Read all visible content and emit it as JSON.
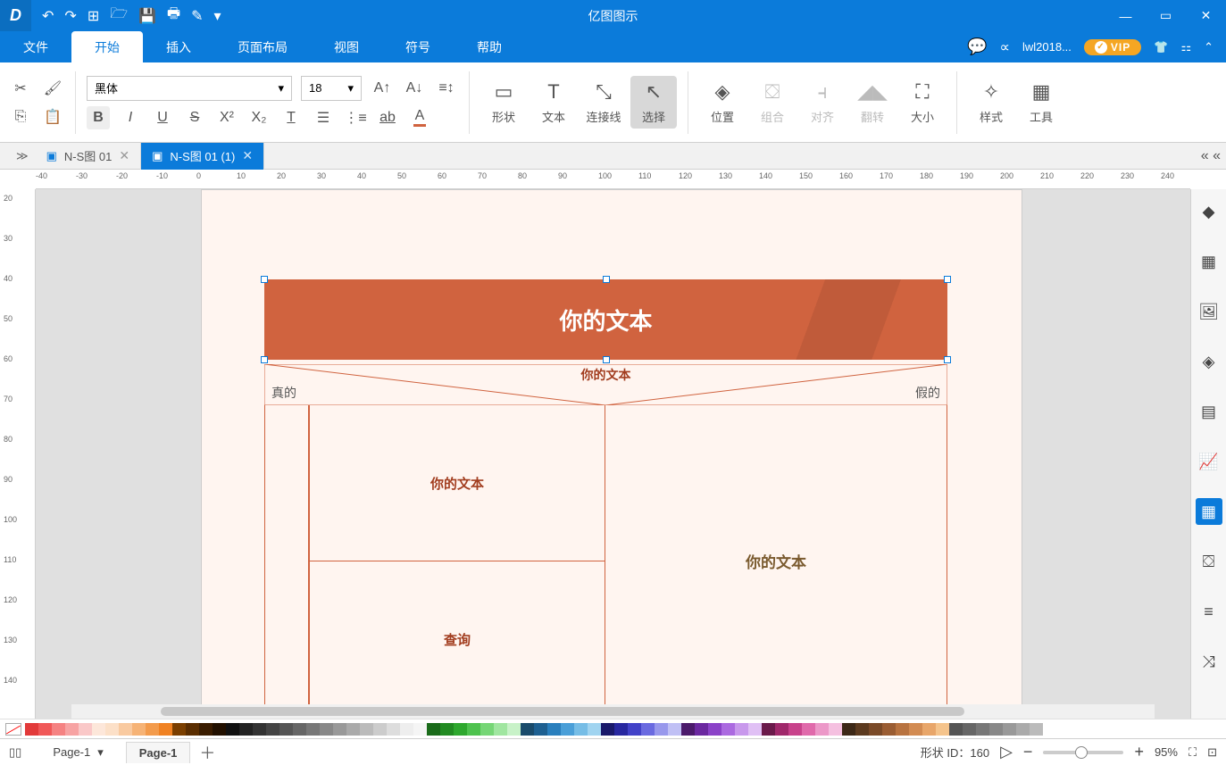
{
  "app": {
    "title": "亿图图示",
    "user": "lwl2018...",
    "vip": "VIP"
  },
  "menu": {
    "file": "文件",
    "home": "开始",
    "insert": "插入",
    "layout": "页面布局",
    "view": "视图",
    "symbol": "符号",
    "help": "帮助"
  },
  "ribbon": {
    "font": "黑体",
    "size": "18",
    "shape": "形状",
    "text": "文本",
    "connector": "连接线",
    "select": "选择",
    "position": "位置",
    "group": "组合",
    "align": "对齐",
    "flip": "翻转",
    "sizebtn": "大小",
    "style": "样式",
    "tools": "工具"
  },
  "tabs": [
    {
      "label": "N-S图 01",
      "active": false
    },
    {
      "label": "N-S图 01 (1)",
      "active": true
    }
  ],
  "canvas": {
    "title": "你的文本",
    "decision": "你的文本",
    "true": "真的",
    "false": "假的",
    "leftbox": "你的文本",
    "query": "查询",
    "rightbox": "你的文本"
  },
  "hruler": [
    -40,
    -30,
    -20,
    -10,
    0,
    10,
    20,
    30,
    40,
    50,
    60,
    70,
    80,
    90,
    100,
    110,
    120,
    130,
    140,
    150,
    160,
    170,
    180,
    190,
    200,
    210,
    220,
    230,
    240
  ],
  "vruler": [
    20,
    30,
    40,
    50,
    60,
    70,
    80,
    90,
    100,
    110,
    120,
    130,
    140
  ],
  "status": {
    "page_sel": "Page-1",
    "page_tab": "Page-1",
    "shape_id": "形状 ID：160",
    "zoom": "95%"
  },
  "swatches": [
    "#e23a3a",
    "#f05858",
    "#f58282",
    "#f7a3a3",
    "#fac8c8",
    "#fde7da",
    "#fce0c8",
    "#f9caa0",
    "#f6b376",
    "#f39b4c",
    "#f08223",
    "#7b3f00",
    "#5a2d00",
    "#3a1c00",
    "#221000",
    "#111",
    "#222",
    "#333",
    "#444",
    "#555",
    "#666",
    "#777",
    "#888",
    "#999",
    "#aaa",
    "#bbb",
    "#ccc",
    "#ddd",
    "#eee",
    "#f5f5f5",
    "#1a6b1a",
    "#228b22",
    "#2ea82e",
    "#4ec24e",
    "#76d676",
    "#a0e6a0",
    "#c8f2c8",
    "#1a4b6b",
    "#1e6091",
    "#2a7fbd",
    "#4a9fd8",
    "#76bde6",
    "#a0d4f0",
    "#1a1a6b",
    "#2828a0",
    "#4242c8",
    "#6a6ae0",
    "#9898ec",
    "#c0c0f5",
    "#4b1a6b",
    "#6b28a0",
    "#8b42c8",
    "#ab6ae0",
    "#c898ec",
    "#e0c0f5",
    "#6b1a4b",
    "#a0286b",
    "#c8428b",
    "#e06aab",
    "#ec98c8",
    "#f5c0e0",
    "#3d2817",
    "#5c3a1f",
    "#7a4a28",
    "#9a5d33",
    "#b87340",
    "#d28b52",
    "#e8a66a",
    "#f5c48c",
    "#555",
    "#666",
    "#777",
    "#888",
    "#999",
    "#aaa",
    "#bbb"
  ]
}
